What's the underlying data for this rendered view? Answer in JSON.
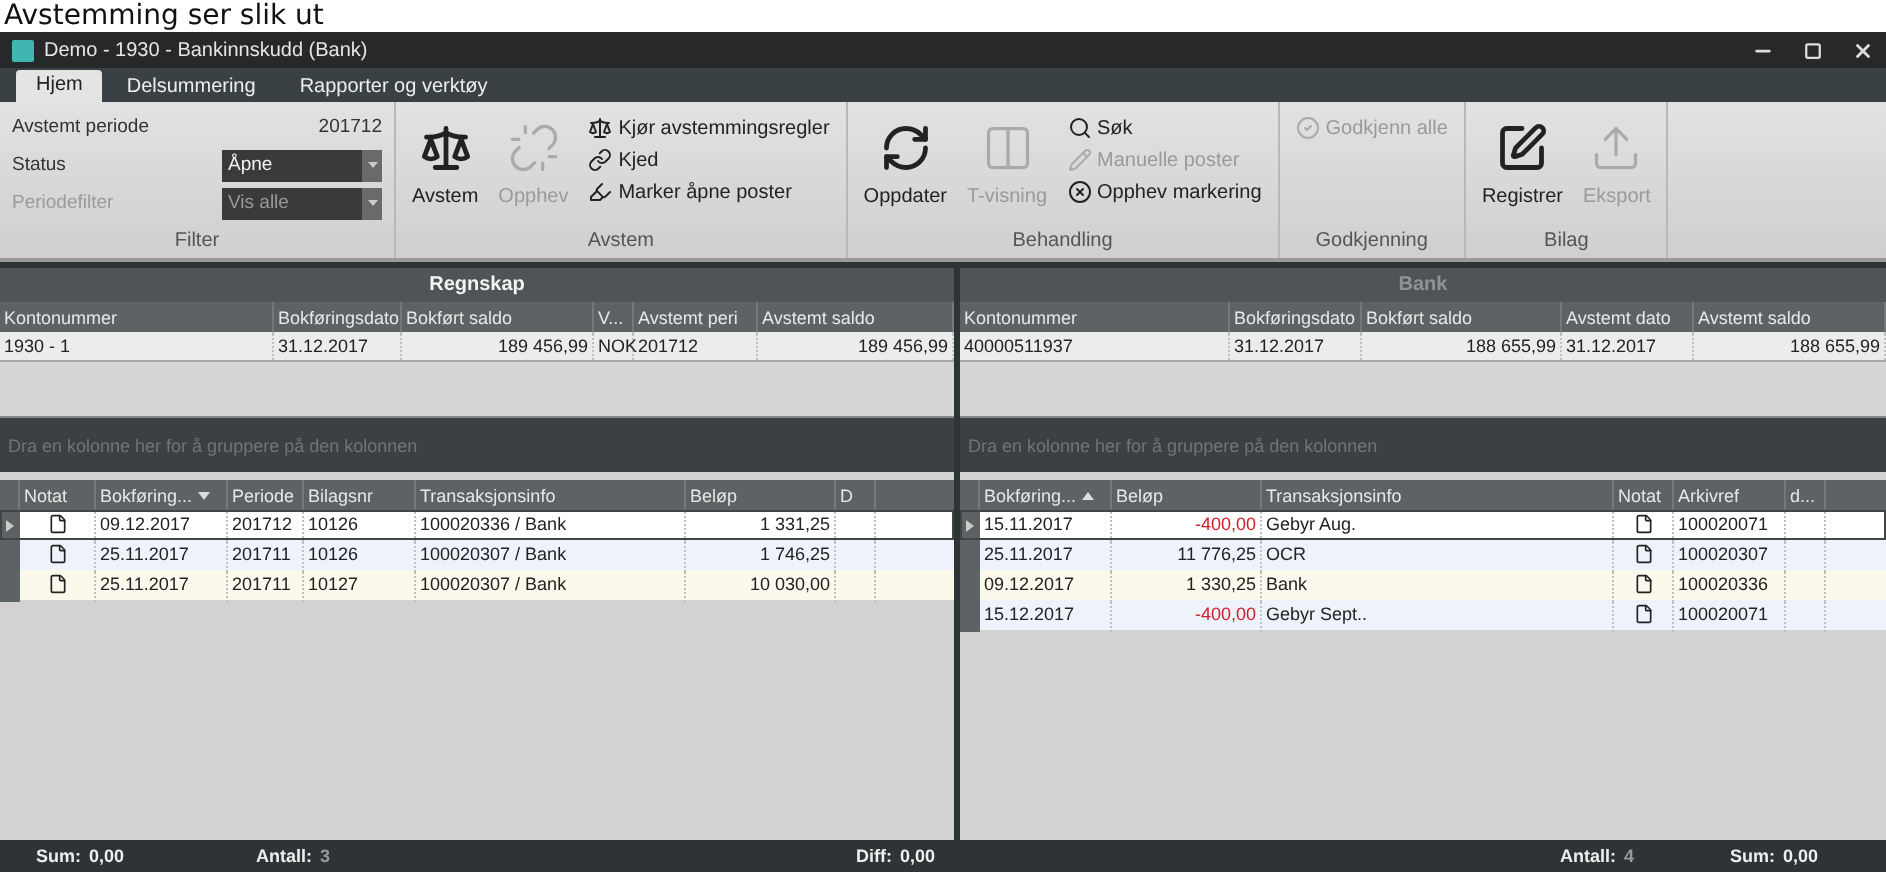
{
  "caption": "Avstemming ser slik ut",
  "window": {
    "title": "Demo - 1930 - Bankinnskudd (Bank)"
  },
  "tabs": [
    {
      "label": "Hjem",
      "selected": true
    },
    {
      "label": "Delsummering",
      "selected": false
    },
    {
      "label": "Rapporter og verktøy",
      "selected": false
    }
  ],
  "ribbon": {
    "filter": {
      "fields": [
        {
          "label": "Avstemt periode",
          "value": "201712",
          "kind": "text",
          "disabled": false
        },
        {
          "label": "Status",
          "value": "Åpne",
          "kind": "dropdown",
          "disabled": false
        },
        {
          "label": "Periodefilter",
          "value": "Vis alle",
          "kind": "dropdown",
          "disabled": true
        }
      ],
      "title": "Filter"
    },
    "groups": [
      {
        "title": "Avstem",
        "large": [
          {
            "label": "Avstem",
            "disabled": false
          },
          {
            "label": "Opphev",
            "disabled": true
          }
        ],
        "small": [
          {
            "label": "Kjør avstemmingsregler",
            "disabled": false
          },
          {
            "label": "Kjed",
            "disabled": false
          },
          {
            "label": "Marker åpne poster",
            "disabled": false
          }
        ]
      },
      {
        "title": "Behandling",
        "large": [
          {
            "label": "Oppdater",
            "disabled": false
          },
          {
            "label": "T-visning",
            "disabled": true
          }
        ],
        "small": [
          {
            "label": "Søk",
            "disabled": false
          },
          {
            "label": "Manuelle poster",
            "disabled": true
          },
          {
            "label": "Opphev markering",
            "disabled": false
          }
        ]
      },
      {
        "title": "Godkjenning",
        "small": [
          {
            "label": "Godkjenn alle",
            "disabled": true
          }
        ]
      },
      {
        "title": "Bilag",
        "large": [
          {
            "label": "Registrer",
            "disabled": false
          },
          {
            "label": "Eksport",
            "disabled": true
          }
        ]
      }
    ]
  },
  "panels": [
    {
      "title": "Regnskap",
      "active": true,
      "summary": {
        "columns": [
          "Kontonummer",
          "Bokføringsdato",
          "Bokført saldo",
          "V...",
          "Avstemt peri",
          "Avstemt saldo"
        ],
        "rows": [
          [
            "1930 - 1",
            "31.12.2017",
            "189 456,99",
            "NOK",
            "201712",
            "189 456,99"
          ]
        ]
      },
      "group_hint": "Dra en kolonne her for å gruppere på den kolonnen",
      "grid": {
        "columns": [
          {
            "label": "Notat",
            "sorted": false
          },
          {
            "label": "Bokføring...",
            "sorted": true,
            "ascending": false
          },
          {
            "label": "Periode",
            "sorted": false
          },
          {
            "label": "Bilagsnr",
            "sorted": false
          },
          {
            "label": "Transaksjonsinfo",
            "sorted": false
          },
          {
            "label": "Beløp",
            "sorted": false
          },
          {
            "label": "D",
            "sorted": false
          }
        ],
        "rows": [
          {
            "selected": true,
            "has_note": true,
            "negative": false,
            "cells": [
              "",
              "09.12.2017",
              "201712",
              "10126",
              "100020336 / Bank",
              "1 331,25"
            ]
          },
          {
            "selected": false,
            "has_note": true,
            "negative": false,
            "cells": [
              "",
              "25.11.2017",
              "201711",
              "10126",
              "100020307 / Bank",
              "1 746,25"
            ]
          },
          {
            "selected": false,
            "has_note": true,
            "negative": false,
            "cells": [
              "",
              "25.11.2017",
              "201711",
              "10127",
              "100020307 / Bank",
              "10 030,00"
            ]
          }
        ]
      }
    },
    {
      "title": "Bank",
      "active": false,
      "summary": {
        "columns": [
          "Kontonummer",
          "Bokføringsdato",
          "Bokført saldo",
          "Avstemt dato",
          "Avstemt saldo"
        ],
        "rows": [
          [
            "40000511937",
            "31.12.2017",
            "188 655,99",
            "31.12.2017",
            "188 655,99"
          ]
        ]
      },
      "group_hint": "Dra en kolonne her for å gruppere på den kolonnen",
      "grid": {
        "columns": [
          {
            "label": "Bokføring...",
            "sorted": true,
            "ascending": true
          },
          {
            "label": "Beløp",
            "sorted": false
          },
          {
            "label": "Transaksjonsinfo",
            "sorted": false
          },
          {
            "label": "Notat",
            "sorted": false
          },
          {
            "label": "Arkivref",
            "sorted": false
          },
          {
            "label": "d...",
            "sorted": false
          }
        ],
        "rows": [
          {
            "selected": true,
            "has_note": true,
            "negative": true,
            "cells": [
              "15.11.2017",
              "-400,00",
              "Gebyr Aug.",
              "",
              "100020071"
            ]
          },
          {
            "selected": false,
            "has_note": true,
            "negative": false,
            "cells": [
              "25.11.2017",
              "11 776,25",
              "OCR",
              "",
              "100020307"
            ]
          },
          {
            "selected": false,
            "has_note": true,
            "negative": false,
            "cells": [
              "09.12.2017",
              "1 330,25",
              "Bank",
              "",
              "100020336"
            ]
          },
          {
            "selected": false,
            "has_note": true,
            "negative": true,
            "cells": [
              "15.12.2017",
              "-400,00",
              "Gebyr Sept..",
              "",
              "100020071"
            ]
          }
        ]
      }
    }
  ],
  "status_bar": {
    "left": [
      {
        "label": "Sum:",
        "value": "0,00"
      },
      {
        "label": "Antall:",
        "value": "3"
      }
    ],
    "diff": {
      "label": "Diff:",
      "value": "0,00"
    },
    "right": [
      {
        "label": "Antall:",
        "value": "4"
      },
      {
        "label": "Sum:",
        "value": "0,00"
      }
    ]
  }
}
